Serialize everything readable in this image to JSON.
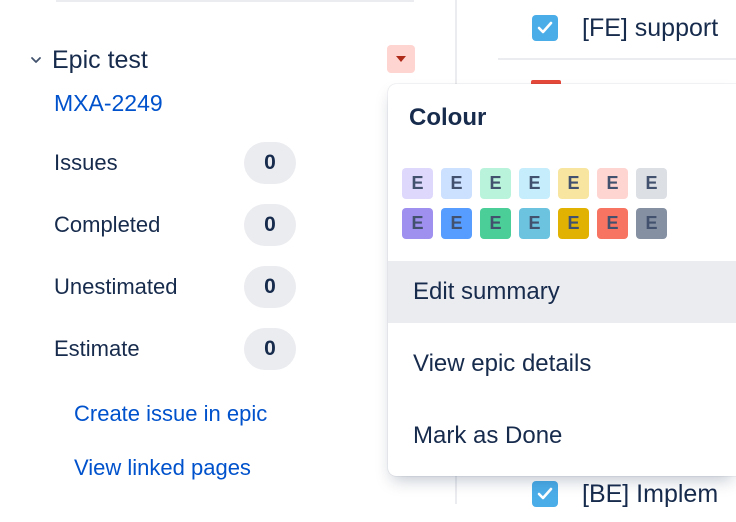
{
  "epic": {
    "title": "Epic test",
    "key": "MXA-2249",
    "stats": [
      {
        "label": "Issues",
        "value": "0"
      },
      {
        "label": "Completed",
        "value": "0"
      },
      {
        "label": "Unestimated",
        "value": "0"
      },
      {
        "label": "Estimate",
        "value": "0"
      }
    ],
    "create_issue_link": "Create issue in epic",
    "view_pages_link": "View linked pages",
    "menu_button_color": "#ffd5d2"
  },
  "issues": {
    "top_summary": "[FE] support",
    "bottom_summary": "[BE] Implem"
  },
  "dropdown": {
    "heading": "Colour",
    "swatch_letter": "E",
    "light_colors": [
      "#dfd8fd",
      "#cce0ff",
      "#baf3db",
      "#c6edfb",
      "#f8e6a0",
      "#ffd5d2",
      "#dcdfe4"
    ],
    "dark_colors": [
      "#9f8fef",
      "#579dff",
      "#4bce97",
      "#6cc3e0",
      "#e2b203",
      "#f87462",
      "#8590a2"
    ],
    "items": [
      "Edit summary",
      "View epic details",
      "Mark as Done"
    ]
  }
}
